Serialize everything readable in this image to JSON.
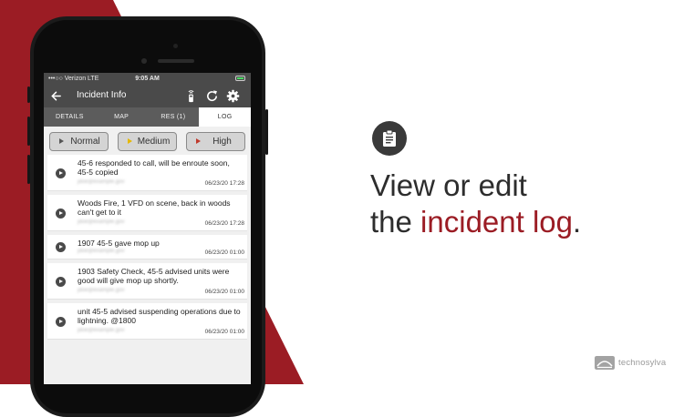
{
  "colors": {
    "accent": "#9b1c24",
    "dark": "#4a4a4a",
    "status_high": "#c0392b",
    "status_medium": "#e6b800"
  },
  "status_bar": {
    "carrier": "•••○○ Verizon  LTE",
    "time": "9:05 AM"
  },
  "app_bar": {
    "title": "Incident Info",
    "icons": [
      "back-arrow-icon",
      "radio-icon",
      "refresh-icon",
      "gear-icon"
    ]
  },
  "tabs": [
    {
      "label": "DETAILS",
      "active": false
    },
    {
      "label": "MAP",
      "active": false
    },
    {
      "label": "RES (1)",
      "active": false
    },
    {
      "label": "LOG",
      "active": true
    }
  ],
  "priorities": [
    {
      "label": "Normal",
      "color": "#555555"
    },
    {
      "label": "Medium",
      "color": "#e6b800"
    },
    {
      "label": "High",
      "color": "#c0392b"
    }
  ],
  "log": [
    {
      "text": "45-6 responded to call, will be enroute soon, 45-5 copied",
      "author": "jdoe@example.gov",
      "time": "06/23/20 17:28"
    },
    {
      "text": "Woods Fire, 1 VFD on scene, back in woods can't get to it",
      "author": "jdoe@example.gov",
      "time": "06/23/20 17:28"
    },
    {
      "text": "1907 45-5 gave mop up",
      "author": "jdoe@example.gov",
      "time": "06/23/20 01:00"
    },
    {
      "text": "1903 Safety Check, 45-5 advised units were good will give mop up shortly.",
      "author": "jdoe@example.gov",
      "time": "06/23/20 01:00"
    },
    {
      "text": "unit 45-5 advised suspending operations due to lightning. @1800",
      "author": "jdoe@example.gov",
      "time": "06/23/20 01:00"
    }
  ],
  "headline": {
    "line1": "View or edit",
    "line2_plain": "the ",
    "line2_accent": "incident log",
    "line2_end": "."
  },
  "brand": {
    "name": "technosylva"
  }
}
